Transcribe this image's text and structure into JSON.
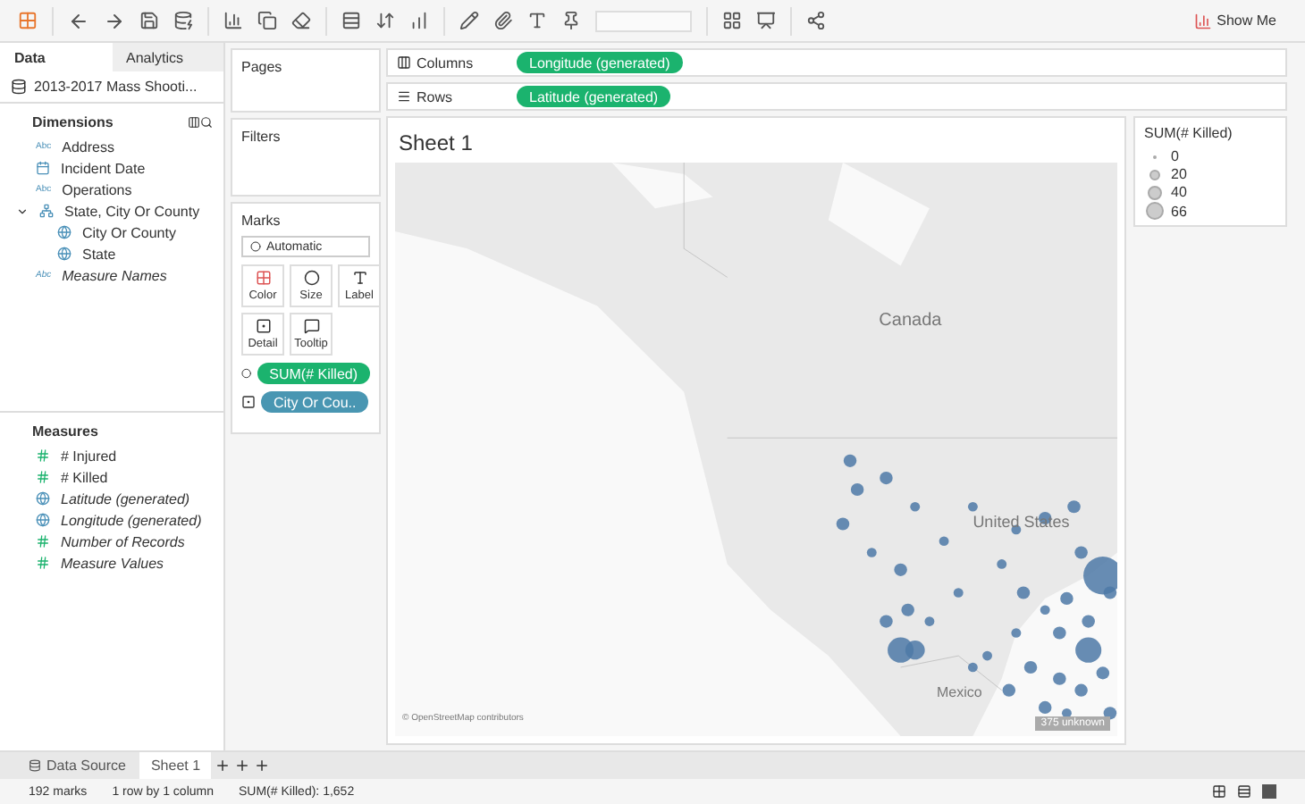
{
  "toolbar": {
    "show_me": "Show Me"
  },
  "data_pane": {
    "tabs": [
      {
        "label": "Data",
        "selected": true
      },
      {
        "label": "Analytics",
        "selected": false
      }
    ],
    "datasource": "2013-2017 Mass Shooti...",
    "dimensions": {
      "title": "Dimensions",
      "items": [
        {
          "kind": "text",
          "glyph": "Abc",
          "label": "Address",
          "italic": false
        },
        {
          "kind": "date",
          "label": "Incident Date",
          "italic": false
        },
        {
          "kind": "text",
          "glyph": "Abc",
          "label": "Operations",
          "italic": false
        },
        {
          "kind": "hierarchy",
          "label": "State, City Or County",
          "italic": false,
          "expanded": true,
          "children": [
            {
              "kind": "geo",
              "label": "City Or County",
              "italic": false
            },
            {
              "kind": "geo",
              "label": "State",
              "italic": false
            }
          ]
        },
        {
          "kind": "text",
          "glyph": "Abc",
          "label": "Measure Names",
          "italic": true
        }
      ]
    },
    "measures": {
      "title": "Measures",
      "items": [
        {
          "kind": "number",
          "label": "# Injured",
          "italic": false
        },
        {
          "kind": "number",
          "label": "# Killed",
          "italic": false
        },
        {
          "kind": "geo",
          "label": "Latitude (generated)",
          "italic": true
        },
        {
          "kind": "geo",
          "label": "Longitude (generated)",
          "italic": true
        },
        {
          "kind": "records",
          "label": "Number of Records",
          "italic": true
        },
        {
          "kind": "number",
          "label": "Measure Values",
          "italic": true
        }
      ]
    }
  },
  "cards": {
    "pages": "Pages",
    "filters": "Filters",
    "marks": {
      "title": "Marks",
      "type": "Automatic",
      "buttons": [
        {
          "kind": "color",
          "label": "Color"
        },
        {
          "kind": "size",
          "label": "Size"
        },
        {
          "kind": "label",
          "label": "Label"
        },
        {
          "kind": "detail",
          "label": "Detail"
        },
        {
          "kind": "tooltip",
          "label": "Tooltip"
        }
      ],
      "pills": [
        {
          "kind": "measure",
          "label": "SUM(# Killed)"
        },
        {
          "kind": "dimension",
          "label": "City Or Cou.."
        }
      ]
    }
  },
  "shelves": [
    {
      "kind": "columns",
      "label": "Columns",
      "pill": "Longitude (generated)"
    },
    {
      "kind": "rows",
      "label": "Rows",
      "pill": "Latitude (generated)"
    }
  ],
  "view": {
    "title": "Sheet 1",
    "map_labels": [
      "Canada",
      "United States",
      "Mexico"
    ],
    "attribution": "© OpenStreetMap contributors",
    "unknown": "375 unknown"
  },
  "legend": {
    "title": "SUM(# Killed)",
    "items": [
      "0",
      "20",
      "40",
      "66"
    ]
  },
  "sheet_tabs": [
    {
      "kind": "datasource",
      "label": "Data Source",
      "selected": false
    },
    {
      "kind": "sheet",
      "label": "Sheet 1",
      "selected": true
    }
  ],
  "status_bar": [
    "192 marks",
    "1 row by 1 column",
    "SUM(# Killed): 1,652"
  ]
}
